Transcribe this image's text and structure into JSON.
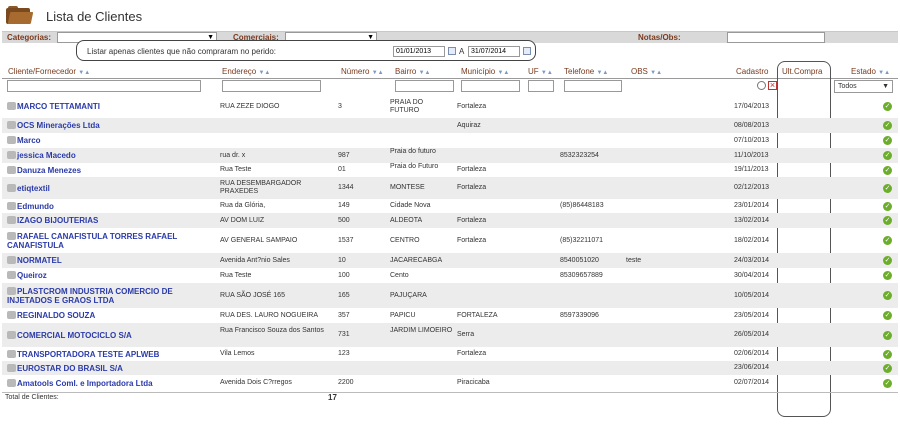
{
  "page": {
    "title": "Lista de Clientes"
  },
  "filters": {
    "categorias_label": "Categorias:",
    "comerciais_label": "Comerciais:",
    "notas_label": "Notas/Obs:",
    "date_label": "Listar apenas clientes que não compraram no perido:",
    "date_from": "01/01/2013",
    "date_sep": "A",
    "date_to": "31/07/2014"
  },
  "columns": {
    "cliente": "Cliente/Fornecedor",
    "endereco": "Endereço",
    "numero": "Número",
    "bairro": "Bairro",
    "municipio": "Município",
    "uf": "UF",
    "telefone": "Telefone",
    "obs": "OBS",
    "cadastro": "Cadastro",
    "ult_compra": "Ult.Compra",
    "estado": "Estado"
  },
  "estado_select": "Todos",
  "rows": [
    {
      "client": "MARCO TETTAMANTI",
      "address": "RUA ZEZE DIOGO",
      "number": "3",
      "bairro": "PRAIA DO FUTURO",
      "municipio": "Fortaleza",
      "telefone": "",
      "obs": "",
      "cadastro": "17/04/2013"
    },
    {
      "client": "OCS Minerações Ltda",
      "address": "",
      "number": "",
      "bairro": "",
      "municipio": "Aquiraz",
      "telefone": "",
      "obs": "",
      "cadastro": "08/08/2013"
    },
    {
      "client": "Marco",
      "address": "",
      "number": "",
      "bairro": "",
      "municipio": "",
      "telefone": "",
      "obs": "",
      "cadastro": "07/10/2013"
    },
    {
      "client": "jessica Macedo",
      "address": "rua dr. x",
      "number": "987",
      "bairro": "Praia do futuro",
      "municipio": "",
      "telefone": "8532323254",
      "obs": "",
      "cadastro": "11/10/2013"
    },
    {
      "client": "Danuza Menezes",
      "address": "Rua Teste",
      "number": "01",
      "bairro": "Praia do Futuro",
      "municipio": "Fortaleza",
      "telefone": "",
      "obs": "",
      "cadastro": "19/11/2013"
    },
    {
      "client": "etiqtextil",
      "address": "RUA DESEMBARGADOR PRAXEDES",
      "number": "1344",
      "bairro": "MONTESE",
      "municipio": "Fortaleza",
      "telefone": "",
      "obs": "",
      "cadastro": "02/12/2013"
    },
    {
      "client": "Edmundo",
      "address": "Rua da Glória,",
      "number": "149",
      "bairro": "Cidade Nova",
      "municipio": "",
      "telefone": "(85)86448183",
      "obs": "",
      "cadastro": "23/01/2014"
    },
    {
      "client": "IZAGO BIJOUTERIAS",
      "address": "AV DOM LUIZ",
      "number": "500",
      "bairro": "ALDEOTA",
      "municipio": "Fortaleza",
      "telefone": "",
      "obs": "",
      "cadastro": "13/02/2014"
    },
    {
      "client": "RAFAEL CANAFISTULA TORRES RAFAEL CANAFISTULA",
      "address": "AV GENERAL SAMPAIO",
      "number": "1537",
      "bairro": "CENTRO",
      "municipio": "Fortaleza",
      "telefone": "(85)32211071",
      "obs": "",
      "cadastro": "18/02/2014"
    },
    {
      "client": "NORMATEL",
      "address": "Avenida Ant?nio Sales",
      "number": "10",
      "bairro": "JACARECABGA",
      "municipio": "",
      "telefone": "8540051020",
      "obs": "teste",
      "cadastro": "24/03/2014"
    },
    {
      "client": "Queiroz",
      "address": "Rua Teste",
      "number": "100",
      "bairro": "Cento",
      "municipio": "",
      "telefone": "85309657889",
      "obs": "",
      "cadastro": "30/04/2014"
    },
    {
      "client": "PLASTCROM INDUSTRIA COMERCIO DE INJETADOS E GRAOS LTDA",
      "address": "RUA SÃO JOSÉ 165",
      "number": "165",
      "bairro": "PAJUÇARA",
      "municipio": "",
      "telefone": "",
      "obs": "",
      "cadastro": "10/05/2014"
    },
    {
      "client": "REGINALDO SOUZA",
      "address": "RUA DES. LAURO NOGUEIRA",
      "number": "357",
      "bairro": "PAPICU",
      "municipio": "FORTALEZA",
      "telefone": "8597339096",
      "obs": "",
      "cadastro": "23/05/2014"
    },
    {
      "client": "COMERCIAL MOTOCICLO S/A",
      "address": "Rua Francisco Souza dos Santos",
      "number": "731",
      "bairro": "JARDIM LIMOEIRO",
      "municipio": "Serra",
      "telefone": "",
      "obs": "",
      "cadastro": "26/05/2014"
    },
    {
      "client": "TRANSPORTADORA TESTE APLWEB",
      "address": "Vila Lemos",
      "number": "123",
      "bairro": "",
      "municipio": "Fortaleza",
      "telefone": "",
      "obs": "",
      "cadastro": "02/06/2014"
    },
    {
      "client": "EUROSTAR DO BRASIL S/A",
      "address": "",
      "number": "",
      "bairro": "",
      "municipio": "",
      "telefone": "",
      "obs": "",
      "cadastro": "23/06/2014"
    },
    {
      "client": "Amatools Coml. e Importadora Ltda",
      "address": "Avenida Dois C?rregos",
      "number": "2200",
      "bairro": "",
      "municipio": "Piracicaba",
      "telefone": "",
      "obs": "",
      "cadastro": "02/07/2014"
    }
  ],
  "footer": {
    "total_label": "Total de Clientes:",
    "total_count": "17"
  }
}
